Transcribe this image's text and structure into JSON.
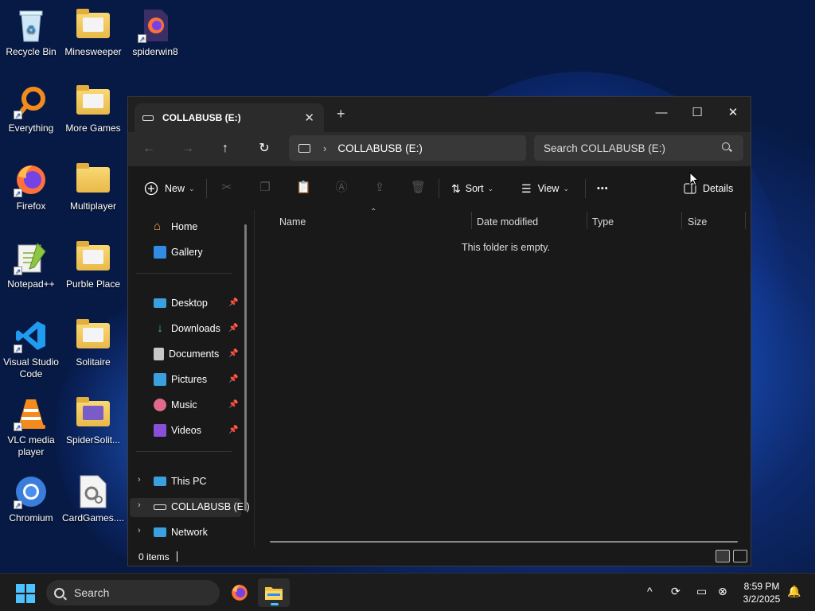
{
  "desktop": {
    "icons": [
      {
        "label": "Recycle Bin"
      },
      {
        "label": "Minesweeper"
      },
      {
        "label": "spiderwin8"
      },
      {
        "label": "Everything"
      },
      {
        "label": "More Games"
      },
      {
        "label": "Firefox"
      },
      {
        "label": "Multiplayer"
      },
      {
        "label": "Notepad++"
      },
      {
        "label": "Purble Place"
      },
      {
        "label": "Visual Studio Code"
      },
      {
        "label": "Solitaire"
      },
      {
        "label": "VLC media player"
      },
      {
        "label": "SpiderSolit..."
      },
      {
        "label": "Chromium"
      },
      {
        "label": "CardGames...."
      }
    ]
  },
  "window": {
    "tab_title": "COLLABUSB (E:)",
    "close_tab_glyph": "✕",
    "new_tab_glyph": "+",
    "minimize_glyph": "—",
    "maximize_glyph": "☐",
    "close_glyph": "✕",
    "address": {
      "back_glyph": "←",
      "forward_glyph": "→",
      "up_glyph": "↑",
      "refresh_glyph": "↻",
      "separator": "›",
      "path": "COLLABUSB (E:)",
      "search_placeholder": "Search COLLABUSB (E:)"
    },
    "toolbar": {
      "new_label": "New",
      "sort_label": "Sort",
      "view_label": "View",
      "more_label": "•••",
      "details_label": "Details",
      "caret": "⌄"
    },
    "nav": {
      "home": "Home",
      "gallery": "Gallery",
      "desktop": "Desktop",
      "downloads": "Downloads",
      "documents": "Documents",
      "pictures": "Pictures",
      "music": "Music",
      "videos": "Videos",
      "this_pc": "This PC",
      "collabusb": "COLLABUSB (E:)",
      "network": "Network",
      "pin_glyph": "📌",
      "chevron": "›"
    },
    "columns": {
      "name": "Name",
      "date_modified": "Date modified",
      "type": "Type",
      "size": "Size"
    },
    "empty_message": "This folder is empty.",
    "status": "0 items"
  },
  "taskbar": {
    "search_label": "Search",
    "time": "8:59 PM",
    "date": "3/2/2025",
    "chevron_up": "^"
  },
  "colors": {
    "accent": "#4cc2ff",
    "window_bg": "#191919",
    "titlebar": "#202020"
  }
}
